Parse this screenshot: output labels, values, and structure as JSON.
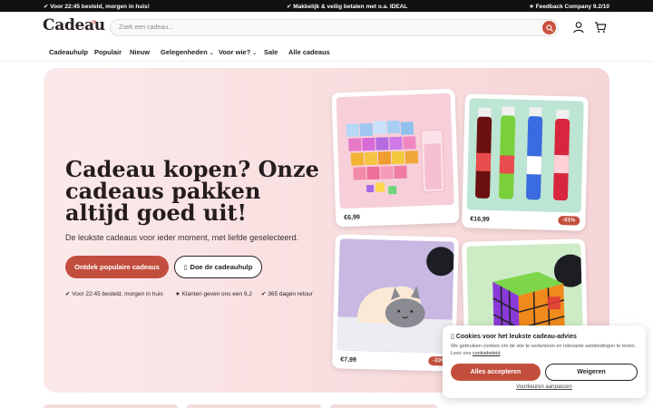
{
  "topbar": {
    "left": "✔ Voor 22:45 besteld, morgen in huis!",
    "center": "✔ Makkelijk & veilig betalen met o.a. IDEAL",
    "right": "★ Feedback Company 9.2/10"
  },
  "header": {
    "logo": "Cadeau",
    "search_placeholder": "Zoek een cadeau..."
  },
  "nav": {
    "items": [
      {
        "label": "Cadeauhulp",
        "dropdown": false
      },
      {
        "label": "Populair",
        "dropdown": false
      },
      {
        "label": "Nieuw",
        "dropdown": false
      },
      {
        "label": "Gelegenheden",
        "dropdown": true
      },
      {
        "label": "Voor wie?",
        "dropdown": true
      },
      {
        "label": "Sale",
        "dropdown": false
      },
      {
        "label": "Alle cadeaus",
        "dropdown": false
      }
    ]
  },
  "hero": {
    "title": "Cadeau kopen? Onze cadeaus pakken altijd goed uit!",
    "subtitle": "De leukste cadeaus voor ieder moment, met liefde geselecteerd.",
    "primary_cta": "Ontdek populaire cadeaus",
    "secondary_cta": "Doe de cadeauhulp",
    "usps": [
      "✔ Voor 22:45 besteld, morgen in huis",
      "★ Klanten geven ons een 9,2",
      "✔ 365 dagen retour"
    ]
  },
  "products": [
    {
      "price": "€6,99",
      "badge": ""
    },
    {
      "price": "€16,99",
      "badge": "-51%"
    },
    {
      "price": "€7,99",
      "badge": "-33%"
    },
    {
      "price": "",
      "badge": ""
    }
  ],
  "cookie": {
    "title": "Cookies voor het leukste cadeau-advies",
    "text": "We gebruiken cookies om de site te verbeteren en relevante aanbiedingen te tonen. Lees ons",
    "link": "cookiebeleid",
    "accept": "Alles accepteren",
    "decline": "Weigeren",
    "preferences": "Voorkeuren aanpassen"
  },
  "colors": {
    "accent": "#c24f3d",
    "hero_bg": "#f9e0e1",
    "topbar_bg": "#111111"
  }
}
